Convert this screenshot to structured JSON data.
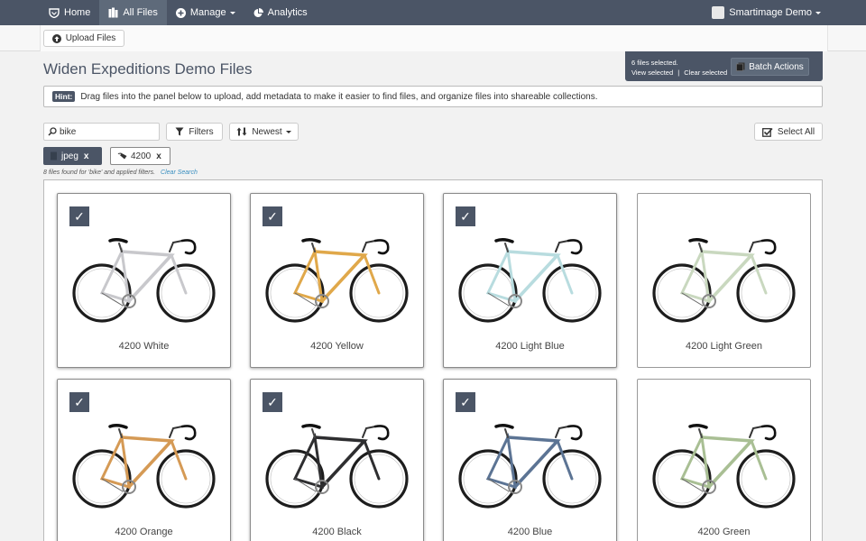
{
  "nav": {
    "home": "Home",
    "all_files": "All Files",
    "manage": "Manage",
    "analytics": "Analytics",
    "user": "Smartimage Demo"
  },
  "toolbar": {
    "upload_label": "Upload Files"
  },
  "page_title": "Widen Expeditions Demo Files",
  "selection": {
    "count_text": "6 files selected.",
    "view_selected": "View selected",
    "separator": "|",
    "clear_selected": "Clear selected",
    "batch_actions": "Batch Actions"
  },
  "hint": {
    "tag": "Hint:",
    "text": "Drag files into the panel below to upload, add metadata to make it easier to find files, and organize files into shareable collections."
  },
  "search": {
    "value": "bike",
    "filters_label": "Filters",
    "sort_label": "Newest",
    "select_all_label": "Select All"
  },
  "active_filters": [
    {
      "label": "jpeg",
      "remove": "x"
    },
    {
      "label": "4200",
      "remove": "x"
    }
  ],
  "results": {
    "found_text": "8 files found for 'bike' and applied filters.",
    "clear_search": "Clear Search"
  },
  "files": [
    {
      "name": "4200 White",
      "selected": true,
      "frame_color": "#c8c8cc",
      "check": "✓"
    },
    {
      "name": "4200 Yellow",
      "selected": true,
      "frame_color": "#e0a84a",
      "check": "✓"
    },
    {
      "name": "4200 Light Blue",
      "selected": true,
      "frame_color": "#b8dcdf",
      "check": "✓"
    },
    {
      "name": "4200 Light Green",
      "selected": false,
      "frame_color": "#c9d8bf",
      "check": ""
    },
    {
      "name": "4200 Orange",
      "selected": true,
      "frame_color": "#d59a55",
      "check": "✓"
    },
    {
      "name": "4200 Black",
      "selected": true,
      "frame_color": "#2e2e30",
      "check": "✓"
    },
    {
      "name": "4200 Blue",
      "selected": true,
      "frame_color": "#5c7494",
      "check": "✓"
    },
    {
      "name": "4200 Green",
      "selected": false,
      "frame_color": "#a9bf94",
      "check": ""
    }
  ],
  "colors": {
    "nav_bg": "#4b5566",
    "accent_link": "#3a8fc0"
  }
}
